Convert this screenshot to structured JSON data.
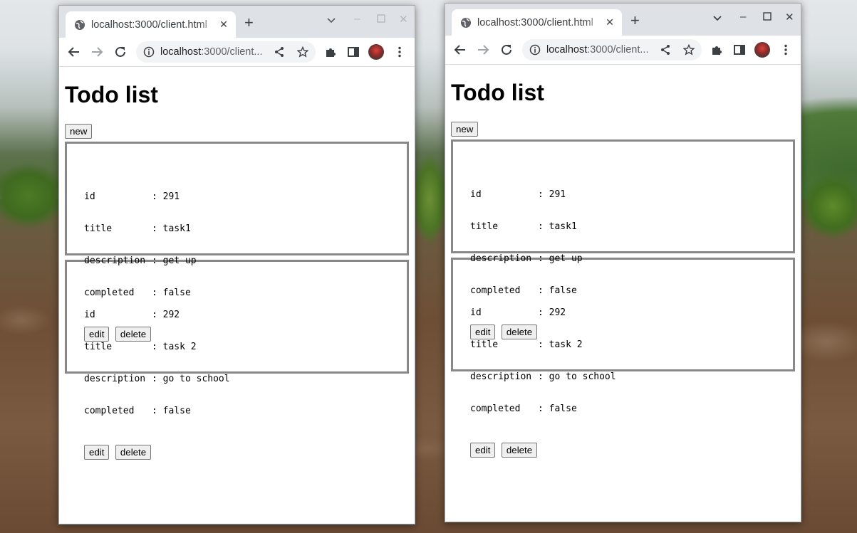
{
  "windows": [
    {
      "tab_title": "localhost:3000/client.html",
      "url_host": "localhost",
      "url_rest": ":3000/client...",
      "page": {
        "heading": "Todo list",
        "new_label": "new",
        "todos": [
          {
            "id_key": "id",
            "id_val": "291",
            "title_key": "title",
            "title_val": "task1",
            "desc_key": "description",
            "desc_val": "get up",
            "comp_key": "completed",
            "comp_val": "false",
            "edit_label": "edit",
            "delete_label": "delete"
          },
          {
            "id_key": "id",
            "id_val": "292",
            "title_key": "title",
            "title_val": "task 2",
            "desc_key": "description",
            "desc_val": "go to school",
            "comp_key": "completed",
            "comp_val": "false",
            "edit_label": "edit",
            "delete_label": "delete"
          }
        ]
      }
    },
    {
      "tab_title": "localhost:3000/client.html",
      "url_host": "localhost",
      "url_rest": ":3000/client...",
      "page": {
        "heading": "Todo list",
        "new_label": "new",
        "todos": [
          {
            "id_key": "id",
            "id_val": "291",
            "title_key": "title",
            "title_val": "task1",
            "desc_key": "description",
            "desc_val": "get up",
            "comp_key": "completed",
            "comp_val": "false",
            "edit_label": "edit",
            "delete_label": "delete"
          },
          {
            "id_key": "id",
            "id_val": "292",
            "title_key": "title",
            "title_val": "task 2",
            "desc_key": "description",
            "desc_val": "go to school",
            "comp_key": "completed",
            "comp_val": "false",
            "edit_label": "edit",
            "delete_label": "delete"
          }
        ]
      }
    }
  ],
  "icons": {
    "favicon": "globe-icon",
    "close": "close-icon",
    "new_tab": "plus-icon",
    "back": "back-arrow-icon",
    "forward": "forward-arrow-icon",
    "reload": "reload-icon",
    "site_info": "info-icon",
    "share": "share-icon",
    "bookmark": "star-icon",
    "extensions": "puzzle-icon",
    "side_panel": "side-panel-icon",
    "menu": "kebab-menu-icon"
  },
  "colors": {
    "tab_strip": "#dee1e6",
    "omnibox": "#f1f3f4",
    "card_border": "#888888"
  }
}
